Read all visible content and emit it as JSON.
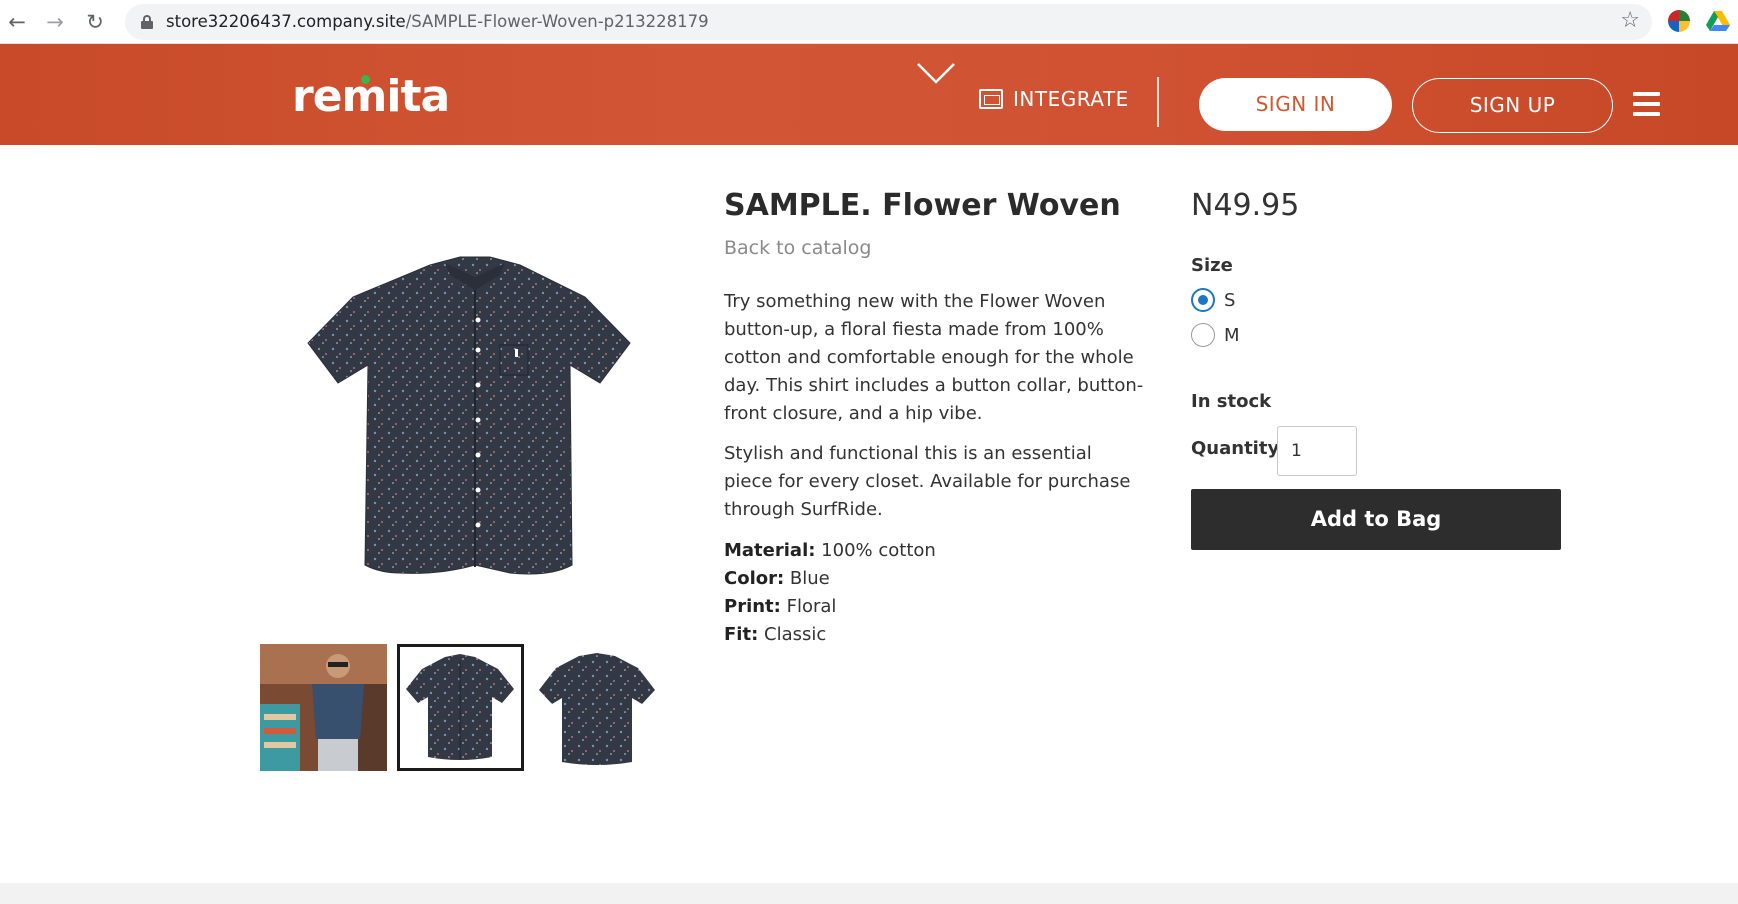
{
  "browser": {
    "url_host": "store32206437.company.site",
    "url_path": "/SAMPLE-Flower-Woven-p213228179"
  },
  "header": {
    "logo": "remita",
    "integrate_label": "INTEGRATE",
    "signin_label": "SIGN IN",
    "signup_label": "SIGN UP"
  },
  "product": {
    "title": "SAMPLE. Flower Woven",
    "back_link": "Back to catalog",
    "description": [
      "Try something new with the Flower Woven button-up, a floral fiesta made from 100% cotton and comfortable enough for the whole day. This shirt includes a button collar, button-front closure, and a hip vibe.",
      "Stylish and functional this is an essential piece for every closet. Available for purchase through SurfRide."
    ],
    "attributes": [
      {
        "key": "Material:",
        "value": "100% cotton"
      },
      {
        "key": "Color:",
        "value": "Blue"
      },
      {
        "key": "Print:",
        "value": "Floral"
      },
      {
        "key": "Fit:",
        "value": "Classic"
      }
    ]
  },
  "purchase": {
    "price": "N49.95",
    "size_label": "Size",
    "sizes": [
      {
        "label": "S",
        "selected": true
      },
      {
        "label": "M",
        "selected": false
      }
    ],
    "stock": "In stock",
    "quantity_label": "Quantity:",
    "quantity_value": "1",
    "add_button": "Add to Bag"
  },
  "colors": {
    "header_bg": "#cf5131",
    "accent_radio": "#1d76c2",
    "button_bg": "#2d2d2d",
    "logo_dot": "#3bb44a"
  }
}
